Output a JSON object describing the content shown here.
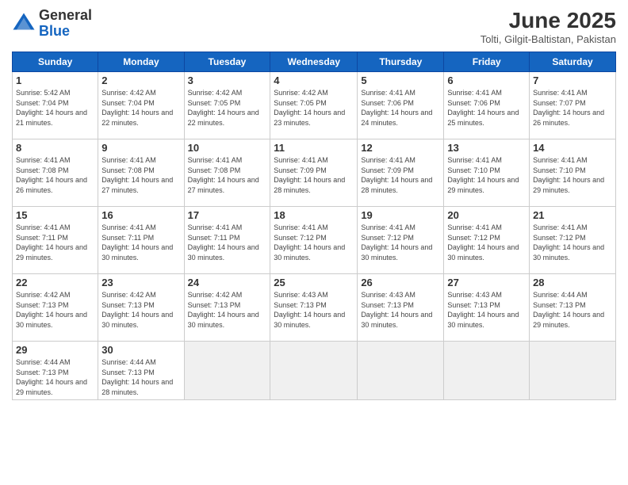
{
  "logo": {
    "general": "General",
    "blue": "Blue"
  },
  "title": "June 2025",
  "location": "Tolti, Gilgit-Baltistan, Pakistan",
  "days": [
    "Sunday",
    "Monday",
    "Tuesday",
    "Wednesday",
    "Thursday",
    "Friday",
    "Saturday"
  ],
  "weeks": [
    [
      {
        "day": "1",
        "sunrise": "Sunrise: 5:42 AM",
        "sunset": "Sunset: 7:04 PM",
        "daylight": "Daylight: 14 hours and 21 minutes."
      },
      {
        "day": "2",
        "sunrise": "Sunrise: 4:42 AM",
        "sunset": "Sunset: 7:04 PM",
        "daylight": "Daylight: 14 hours and 22 minutes."
      },
      {
        "day": "3",
        "sunrise": "Sunrise: 4:42 AM",
        "sunset": "Sunset: 7:05 PM",
        "daylight": "Daylight: 14 hours and 22 minutes."
      },
      {
        "day": "4",
        "sunrise": "Sunrise: 4:42 AM",
        "sunset": "Sunset: 7:05 PM",
        "daylight": "Daylight: 14 hours and 23 minutes."
      },
      {
        "day": "5",
        "sunrise": "Sunrise: 4:41 AM",
        "sunset": "Sunset: 7:06 PM",
        "daylight": "Daylight: 14 hours and 24 minutes."
      },
      {
        "day": "6",
        "sunrise": "Sunrise: 4:41 AM",
        "sunset": "Sunset: 7:06 PM",
        "daylight": "Daylight: 14 hours and 25 minutes."
      },
      {
        "day": "7",
        "sunrise": "Sunrise: 4:41 AM",
        "sunset": "Sunset: 7:07 PM",
        "daylight": "Daylight: 14 hours and 26 minutes."
      }
    ],
    [
      {
        "day": "8",
        "sunrise": "Sunrise: 4:41 AM",
        "sunset": "Sunset: 7:08 PM",
        "daylight": "Daylight: 14 hours and 26 minutes."
      },
      {
        "day": "9",
        "sunrise": "Sunrise: 4:41 AM",
        "sunset": "Sunset: 7:08 PM",
        "daylight": "Daylight: 14 hours and 27 minutes."
      },
      {
        "day": "10",
        "sunrise": "Sunrise: 4:41 AM",
        "sunset": "Sunset: 7:08 PM",
        "daylight": "Daylight: 14 hours and 27 minutes."
      },
      {
        "day": "11",
        "sunrise": "Sunrise: 4:41 AM",
        "sunset": "Sunset: 7:09 PM",
        "daylight": "Daylight: 14 hours and 28 minutes."
      },
      {
        "day": "12",
        "sunrise": "Sunrise: 4:41 AM",
        "sunset": "Sunset: 7:09 PM",
        "daylight": "Daylight: 14 hours and 28 minutes."
      },
      {
        "day": "13",
        "sunrise": "Sunrise: 4:41 AM",
        "sunset": "Sunset: 7:10 PM",
        "daylight": "Daylight: 14 hours and 29 minutes."
      },
      {
        "day": "14",
        "sunrise": "Sunrise: 4:41 AM",
        "sunset": "Sunset: 7:10 PM",
        "daylight": "Daylight: 14 hours and 29 minutes."
      }
    ],
    [
      {
        "day": "15",
        "sunrise": "Sunrise: 4:41 AM",
        "sunset": "Sunset: 7:11 PM",
        "daylight": "Daylight: 14 hours and 29 minutes."
      },
      {
        "day": "16",
        "sunrise": "Sunrise: 4:41 AM",
        "sunset": "Sunset: 7:11 PM",
        "daylight": "Daylight: 14 hours and 30 minutes."
      },
      {
        "day": "17",
        "sunrise": "Sunrise: 4:41 AM",
        "sunset": "Sunset: 7:11 PM",
        "daylight": "Daylight: 14 hours and 30 minutes."
      },
      {
        "day": "18",
        "sunrise": "Sunrise: 4:41 AM",
        "sunset": "Sunset: 7:12 PM",
        "daylight": "Daylight: 14 hours and 30 minutes."
      },
      {
        "day": "19",
        "sunrise": "Sunrise: 4:41 AM",
        "sunset": "Sunset: 7:12 PM",
        "daylight": "Daylight: 14 hours and 30 minutes."
      },
      {
        "day": "20",
        "sunrise": "Sunrise: 4:41 AM",
        "sunset": "Sunset: 7:12 PM",
        "daylight": "Daylight: 14 hours and 30 minutes."
      },
      {
        "day": "21",
        "sunrise": "Sunrise: 4:41 AM",
        "sunset": "Sunset: 7:12 PM",
        "daylight": "Daylight: 14 hours and 30 minutes."
      }
    ],
    [
      {
        "day": "22",
        "sunrise": "Sunrise: 4:42 AM",
        "sunset": "Sunset: 7:13 PM",
        "daylight": "Daylight: 14 hours and 30 minutes."
      },
      {
        "day": "23",
        "sunrise": "Sunrise: 4:42 AM",
        "sunset": "Sunset: 7:13 PM",
        "daylight": "Daylight: 14 hours and 30 minutes."
      },
      {
        "day": "24",
        "sunrise": "Sunrise: 4:42 AM",
        "sunset": "Sunset: 7:13 PM",
        "daylight": "Daylight: 14 hours and 30 minutes."
      },
      {
        "day": "25",
        "sunrise": "Sunrise: 4:43 AM",
        "sunset": "Sunset: 7:13 PM",
        "daylight": "Daylight: 14 hours and 30 minutes."
      },
      {
        "day": "26",
        "sunrise": "Sunrise: 4:43 AM",
        "sunset": "Sunset: 7:13 PM",
        "daylight": "Daylight: 14 hours and 30 minutes."
      },
      {
        "day": "27",
        "sunrise": "Sunrise: 4:43 AM",
        "sunset": "Sunset: 7:13 PM",
        "daylight": "Daylight: 14 hours and 30 minutes."
      },
      {
        "day": "28",
        "sunrise": "Sunrise: 4:44 AM",
        "sunset": "Sunset: 7:13 PM",
        "daylight": "Daylight: 14 hours and 29 minutes."
      }
    ],
    [
      {
        "day": "29",
        "sunrise": "Sunrise: 4:44 AM",
        "sunset": "Sunset: 7:13 PM",
        "daylight": "Daylight: 14 hours and 29 minutes."
      },
      {
        "day": "30",
        "sunrise": "Sunrise: 4:44 AM",
        "sunset": "Sunset: 7:13 PM",
        "daylight": "Daylight: 14 hours and 28 minutes."
      },
      null,
      null,
      null,
      null,
      null
    ]
  ]
}
